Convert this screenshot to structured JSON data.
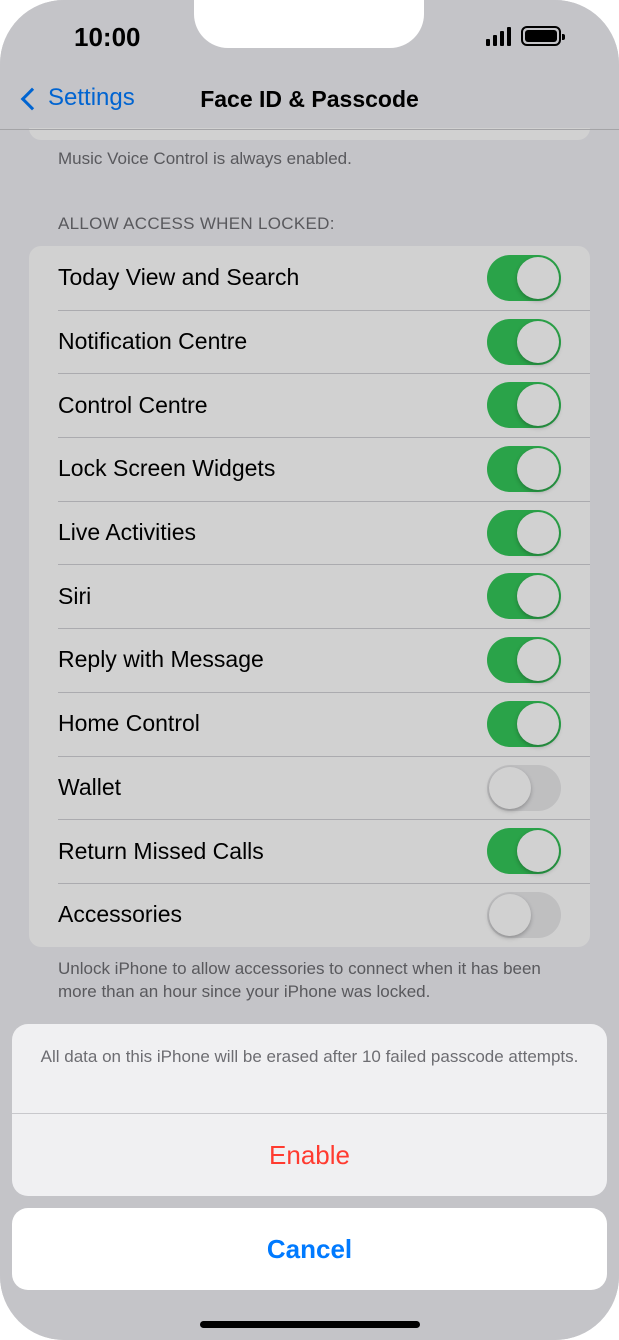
{
  "status": {
    "time": "10:00"
  },
  "nav": {
    "back_label": "Settings",
    "title": "Face ID & Passcode"
  },
  "voice_footnote": "Music Voice Control is always enabled.",
  "section_header": "ALLOW ACCESS WHEN LOCKED:",
  "rows": [
    {
      "label": "Today View and Search",
      "on": true
    },
    {
      "label": "Notification Centre",
      "on": true
    },
    {
      "label": "Control Centre",
      "on": true
    },
    {
      "label": "Lock Screen Widgets",
      "on": true
    },
    {
      "label": "Live Activities",
      "on": true
    },
    {
      "label": "Siri",
      "on": true
    },
    {
      "label": "Reply with Message",
      "on": true
    },
    {
      "label": "Home Control",
      "on": true
    },
    {
      "label": "Wallet",
      "on": false
    },
    {
      "label": "Return Missed Calls",
      "on": true
    },
    {
      "label": "Accessories",
      "on": false
    }
  ],
  "accessories_footnote": "Unlock iPhone to allow accessories to connect when it has been more than an hour since your iPhone was locked.",
  "sheet": {
    "message": "All data on this iPhone will be erased after 10 failed passcode attempts.",
    "enable_label": "Enable",
    "cancel_label": "Cancel"
  },
  "colors": {
    "accent": "#007aff",
    "toggle_on": "#34c759",
    "destructive": "#ff3b30"
  }
}
